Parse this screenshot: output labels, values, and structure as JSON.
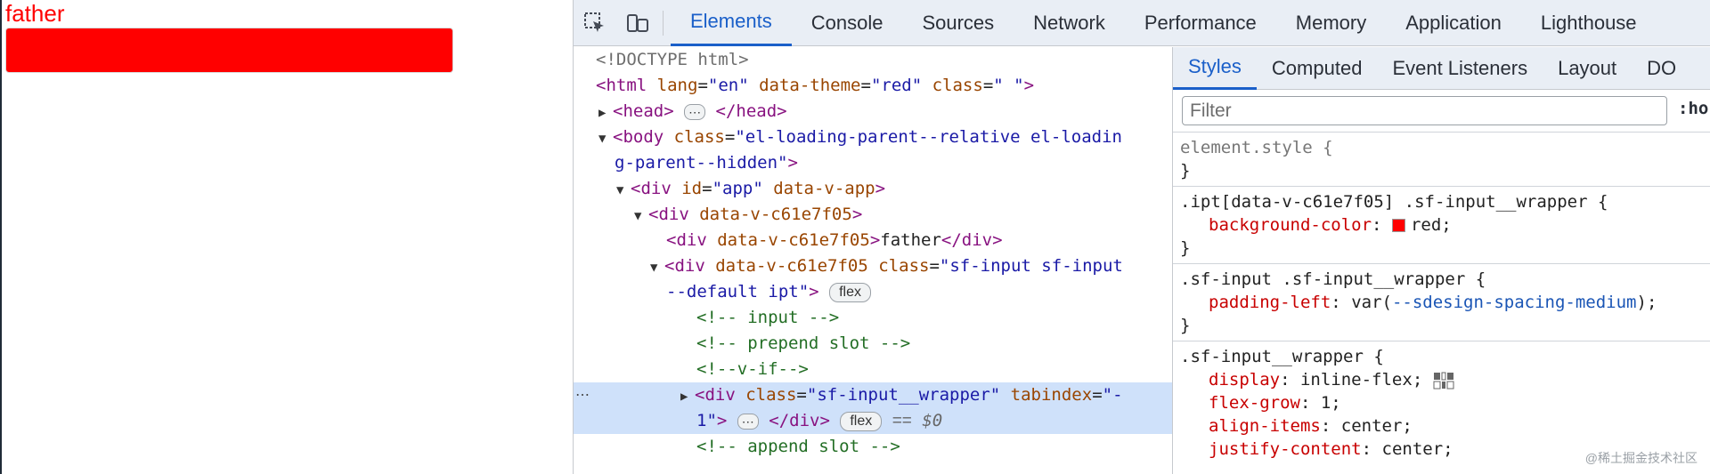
{
  "preview": {
    "father_text": "father",
    "box_color": "#ff0000"
  },
  "devtools": {
    "tabs": [
      {
        "label": "Elements",
        "active": true
      },
      {
        "label": "Console"
      },
      {
        "label": "Sources"
      },
      {
        "label": "Network"
      },
      {
        "label": "Performance"
      },
      {
        "label": "Memory"
      },
      {
        "label": "Application"
      },
      {
        "label": "Lighthouse"
      }
    ],
    "icons": {
      "inspect": "select-element-icon",
      "device": "device-toolbar-icon"
    },
    "tree": {
      "doctype": "<!DOCTYPE html>",
      "html_tag": "html",
      "html_attr1": "lang",
      "html_val1": "\"en\"",
      "html_attr2": "data-theme",
      "html_val2": "\"red\"",
      "html_attr3": "class",
      "html_val3": "\" \"",
      "head_open": "<head>",
      "head_close": "</head>",
      "body_tag": "<body",
      "body_attr": "class",
      "body_val1": "\"el-loading-parent--relative el-loadin",
      "body_val2": "g-parent--hidden\"",
      "app_tag": "<div",
      "app_attr1": "id",
      "app_val1": "\"app\"",
      "app_attr2": "data-v-app",
      "div_c61_tag": "<div",
      "div_c61_attr": "data-v-c61e7f05",
      "father_div_tag": "<div",
      "father_div_attr": "data-v-c61e7f05",
      "father_div_text": "father",
      "father_div_close": "</div>",
      "sfinput_tag": "<div",
      "sfinput_attr1": "data-v-c61e7f05",
      "sfinput_attr2": "class",
      "sfinput_val1": "\"sf-input sf-input",
      "sfinput_val2": "--default ipt\"",
      "pill_flex": "flex",
      "comment_input": "<!-- input -->",
      "comment_prepend": "<!-- prepend slot -->",
      "comment_vif": "<!--v-if-->",
      "wrapper_tag": "<div",
      "wrapper_attr1": "class",
      "wrapper_val1": "\"sf-input__wrapper\"",
      "wrapper_attr2": "tabindex",
      "wrapper_val2a": "\"-",
      "wrapper_val2b": "1\"",
      "wrapper_close": "</div>",
      "eq_sign": "==",
      "dollar0": "$0",
      "comment_append": "<!-- append slot -->",
      "gutter_dots": "⋯",
      "ellipsis": "⋯"
    },
    "styles": {
      "subtabs": [
        {
          "label": "Styles",
          "active": true
        },
        {
          "label": "Computed"
        },
        {
          "label": "Event Listeners"
        },
        {
          "label": "Layout"
        },
        {
          "label": "DO"
        }
      ],
      "filter_placeholder": "Filter",
      "hov": ":ho",
      "rules": {
        "r0_selector": "element.style {",
        "r0_close": "}",
        "r1_selector": ".ipt[data-v-c61e7f05] .sf-input__wrapper {",
        "r1_p1_name": "background-color",
        "r1_p1_value": "red;",
        "r1_close": "}",
        "r2_selector": ".sf-input .sf-input__wrapper {",
        "r2_p1_name": "padding-left",
        "r2_p1_pre": "var(",
        "r2_p1_var": "--sdesign-spacing-medium",
        "r2_p1_post": ");",
        "r2_close": "}",
        "r3_selector": ".sf-input__wrapper {",
        "r3_p1_name": "display",
        "r3_p1_value": "inline-flex;",
        "r3_p2_name": "flex-grow",
        "r3_p2_value": "1;",
        "r3_p3_name": "align-items",
        "r3_p3_value": "center;",
        "r3_p4_name": "justify-content",
        "r3_p4_value": "center;"
      },
      "swatch_color": "#ff0000",
      "colon": ":"
    },
    "watermark": "@稀土掘金技术社区"
  }
}
